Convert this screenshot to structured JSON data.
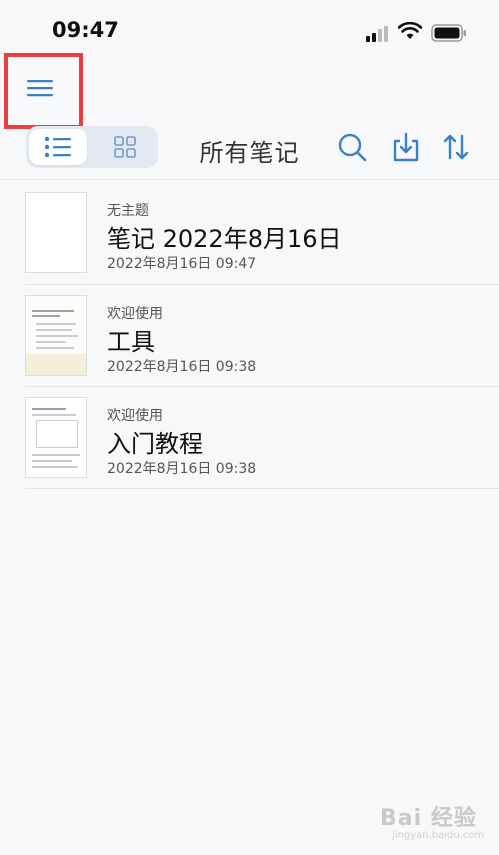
{
  "status_bar": {
    "time": "09:47",
    "icons": [
      "signal-icon",
      "wifi-icon",
      "battery-icon"
    ]
  },
  "nav": {
    "title": "所有笔记",
    "menu_icon": "hamburger-menu-icon",
    "highlight_color": "#e84040"
  },
  "toolbar": {
    "view_modes": [
      "list-view-icon",
      "grid-view-icon"
    ],
    "active_view": "list",
    "actions": [
      "search-icon",
      "import-icon",
      "sort-icon"
    ],
    "accent_color": "#3d7fc4"
  },
  "notes": [
    {
      "label": "无主题",
      "title": "笔记 2022年8月16日",
      "date": "2022年8月16日 09:47"
    },
    {
      "label": "欢迎使用",
      "title": "工具",
      "date": "2022年8月16日 09:38"
    },
    {
      "label": "欢迎使用",
      "title": "入门教程",
      "date": "2022年8月16日 09:38"
    }
  ],
  "watermark": {
    "text": "Bai 经验",
    "subtext": "jingyan.baidu.com"
  }
}
